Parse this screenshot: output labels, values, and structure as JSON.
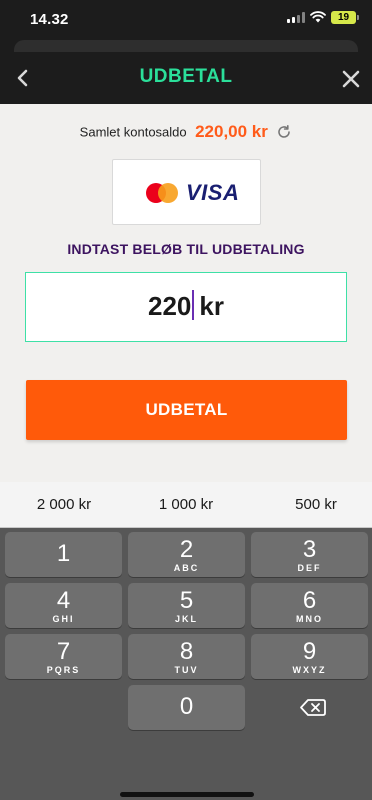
{
  "status_bar": {
    "time": "14.32",
    "battery": "19"
  },
  "header": {
    "title": "UDBETAL",
    "back_icon": "chevron-left-icon",
    "close_icon": "close-icon"
  },
  "balance": {
    "label": "Samlet kontosaldo",
    "value": "220,00 kr",
    "refresh_icon": "refresh-icon"
  },
  "payment_logo": {
    "brand": "VISA"
  },
  "instruction": "INDTAST BELØB TIL UDBETALING",
  "amount_input": {
    "value": "220",
    "currency": "kr"
  },
  "submit_label": "UDBETAL",
  "quick_amounts": [
    "2 000 kr",
    "1 000 kr",
    "500 kr"
  ],
  "keypad": {
    "keys": [
      {
        "digit": "1",
        "letters": ""
      },
      {
        "digit": "2",
        "letters": "ABC"
      },
      {
        "digit": "3",
        "letters": "DEF"
      },
      {
        "digit": "4",
        "letters": "GHI"
      },
      {
        "digit": "5",
        "letters": "JKL"
      },
      {
        "digit": "6",
        "letters": "MNO"
      },
      {
        "digit": "7",
        "letters": "PQRS"
      },
      {
        "digit": "8",
        "letters": "TUV"
      },
      {
        "digit": "9",
        "letters": "WXYZ"
      },
      {
        "digit": "0",
        "letters": ""
      }
    ],
    "delete_icon": "backspace-icon"
  },
  "colors": {
    "accent_green": "#2bdf9a",
    "accent_orange": "#ff5a0a",
    "instruction_purple": "#3d1460",
    "header_bg": "#1c1c1c",
    "keyboard_bg": "#575757"
  }
}
